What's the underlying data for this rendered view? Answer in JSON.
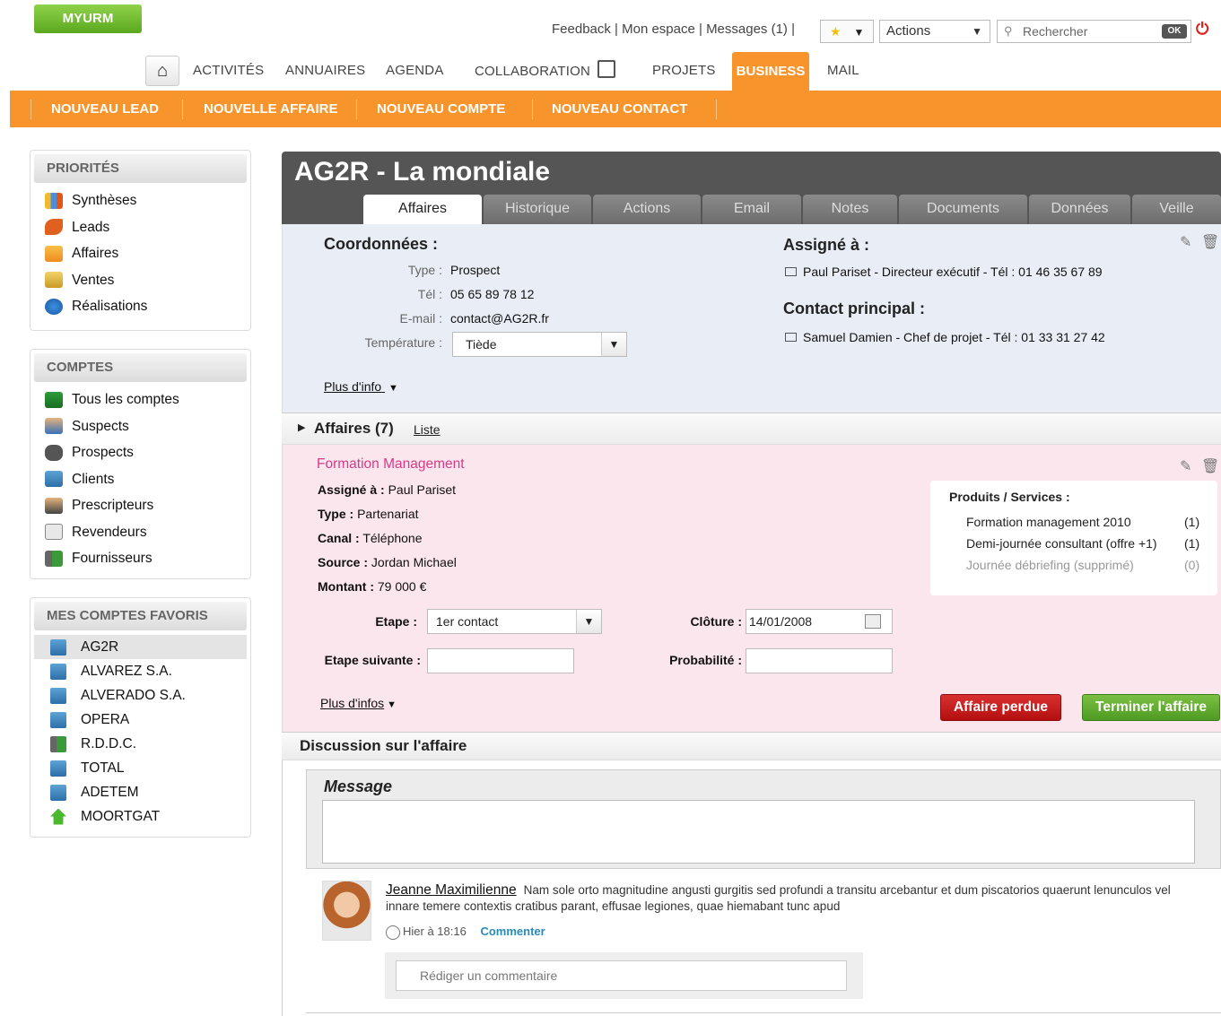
{
  "header": {
    "logo": "MYURM",
    "links": [
      "Feedback",
      "Mon espace",
      "Messages (1)"
    ],
    "actions_select": "Actions",
    "search_placeholder": "Rechercher",
    "search_button": "OK"
  },
  "nav": {
    "items": [
      "ACTIVITÉS",
      "ANNUAIRES",
      "AGENDA",
      "COLLABORATION",
      "PROJETS",
      "BUSINESS",
      "MAIL"
    ],
    "active": "BUSINESS",
    "sub_items": [
      "NOUVEAU LEAD",
      "NOUVELLE AFFAIRE",
      "NOUVEAU COMPTE",
      "NOUVEAU CONTACT"
    ]
  },
  "sidebar": {
    "priorites": {
      "title": "PRIORITÉS",
      "items": [
        "Synthèses",
        "Leads",
        "Affaires",
        "Ventes",
        "Réalisations"
      ]
    },
    "comptes": {
      "title": "COMPTES",
      "items": [
        "Tous les comptes",
        "Suspects",
        "Prospects",
        "Clients",
        "Prescripteurs",
        "Revendeurs",
        "Fournisseurs"
      ]
    },
    "favoris": {
      "title": "MES COMPTES FAVORIS",
      "items": [
        "AG2R",
        "ALVAREZ S.A.",
        "ALVERADO S.A.",
        "OPERA",
        "R.D.D.C.",
        "TOTAL",
        "ADETEM",
        "MOORTGAT"
      ],
      "selected": "AG2R"
    }
  },
  "main": {
    "title": "AG2R - La mondiale",
    "tabs": [
      "Affaires",
      "Historique",
      "Actions",
      "Email",
      "Notes",
      "Documents",
      "Données",
      "Veille"
    ],
    "active_tab": "Affaires",
    "coordonnees": {
      "title": "Coordonnées :",
      "type_label": "Type :",
      "type": "Prospect",
      "tel_label": "Tél :",
      "tel": "05 65 89 78 12",
      "email_label": "E-mail :",
      "email": "contact@AG2R.fr",
      "temperature_label": "Température :",
      "temperature": "Tiède",
      "more": "Plus d'info"
    },
    "assigne": {
      "title": "Assigné à :",
      "value": "Paul Pariset - Directeur exécutif - Tél : 01 46 35 67 89"
    },
    "contact": {
      "title": "Contact principal :",
      "value": "Samuel Damien  - Chef de projet - Tél : 01 33 31 27 42"
    },
    "affaires": {
      "title": "Affaires (7)",
      "list_link": "Liste",
      "name": "Formation Management",
      "assigne_label": "Assigné à :",
      "assigne": "Paul Pariset",
      "type_label": "Type :",
      "type": "Partenariat",
      "canal_label": "Canal :",
      "canal": "Téléphone",
      "source_label": "Source :",
      "source": "Jordan Michael",
      "montant_label": "Montant :",
      "montant": "79 000 €",
      "etape_label": "Etape :",
      "etape": "1er contact",
      "etape_suivante_label": "Etape suivante :",
      "etape_suivante": "",
      "cloture_label": "Clôture :",
      "cloture": "14/01/2008",
      "probabilite_label": "Probabilité :",
      "probabilite": "",
      "more": "Plus d'infos",
      "btn_lost": "Affaire perdue",
      "btn_finish": "Terminer l'affaire",
      "products_title": "Produits / Services :",
      "products": [
        {
          "name": "Formation management 2010",
          "count": "(1)"
        },
        {
          "name": "Demi-journée consultant (offre +1)",
          "count": "(1)"
        },
        {
          "name": "Journée débriefing (supprimé)",
          "count": "(0)"
        }
      ]
    },
    "discussion": {
      "title": "Discussion sur l'affaire",
      "message_label": "Message",
      "author": "Jeanne Maximilienne",
      "text": "Nam sole orto magnitudine angusti gurgitis sed profundi a transitu arcebantur et dum piscatorios quaerunt lenunculos vel innare temere contextis cratibus parant, effusae legiones, quae hiemabant tunc apud",
      "time": "Hier  à 18:16",
      "comment_link": "Commenter",
      "comment_placeholder": "Rédiger un commentaire"
    }
  }
}
